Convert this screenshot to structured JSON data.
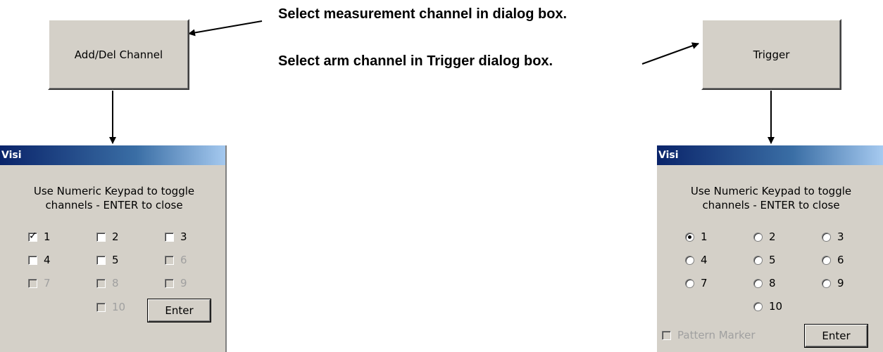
{
  "left": {
    "button_label": "Add/Del Channel",
    "dialog": {
      "title": "Visi",
      "instruction_line1": "Use Numeric Keypad to toggle",
      "instruction_line2": "channels - ENTER to close",
      "options": [
        {
          "label": "1",
          "checked": true,
          "enabled": true
        },
        {
          "label": "2",
          "checked": false,
          "enabled": true
        },
        {
          "label": "3",
          "checked": false,
          "enabled": true
        },
        {
          "label": "4",
          "checked": false,
          "enabled": true
        },
        {
          "label": "5",
          "checked": false,
          "enabled": true
        },
        {
          "label": "6",
          "checked": false,
          "enabled": false
        },
        {
          "label": "7",
          "checked": false,
          "enabled": false
        },
        {
          "label": "8",
          "checked": false,
          "enabled": false
        },
        {
          "label": "9",
          "checked": false,
          "enabled": false
        },
        {
          "label": "10",
          "checked": false,
          "enabled": false
        }
      ],
      "enter_label": "Enter"
    }
  },
  "right": {
    "button_label": "Trigger",
    "dialog": {
      "title": "Visi",
      "instruction_line1": "Use Numeric Keypad to toggle",
      "instruction_line2": "channels - ENTER to close",
      "options": [
        {
          "label": "1",
          "selected": true
        },
        {
          "label": "2",
          "selected": false
        },
        {
          "label": "3",
          "selected": false
        },
        {
          "label": "4",
          "selected": false
        },
        {
          "label": "5",
          "selected": false
        },
        {
          "label": "6",
          "selected": false
        },
        {
          "label": "7",
          "selected": false
        },
        {
          "label": "8",
          "selected": false
        },
        {
          "label": "9",
          "selected": false
        },
        {
          "label": "10",
          "selected": false
        }
      ],
      "pattern_marker_label": "Pattern Marker",
      "enter_label": "Enter"
    }
  },
  "annotations": {
    "measurement": "Select measurement channel in dialog box.",
    "arm": "Select arm channel in Trigger dialog box."
  }
}
